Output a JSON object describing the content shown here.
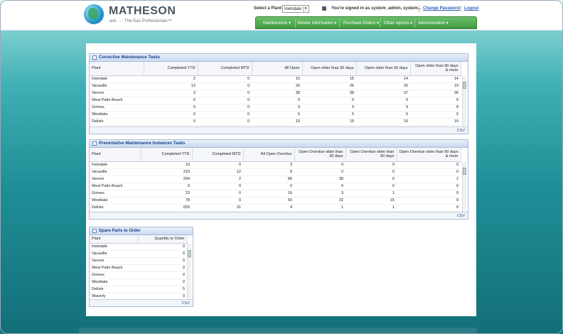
{
  "header": {
    "brand": "MATHESON",
    "tagline": "ask . . . The Gas Professionals™",
    "plant_label": "Select a Plant",
    "plant_value": "Irwindale",
    "signed_in": "You're signed in as system_admin, system...",
    "change_password": "Change Password",
    "logout": "Logout"
  },
  "nav": [
    "Maintenance ▾",
    "Vendor Information ▾",
    "Purchase Orders ▾",
    "Other reports ▾",
    "Administration ▾"
  ],
  "corrective": {
    "title": "Corrective Maintenance Tasks",
    "columns": [
      "Plant",
      "Completed YTD",
      "Completed MTD",
      "All Open",
      "Open older than 30 days",
      "Open older than 60 days",
      "Open older than 90 days & more"
    ],
    "rows": [
      [
        "Irwindale",
        "2",
        "0",
        "15",
        "15",
        "14",
        "14"
      ],
      [
        "Vacaville",
        "13",
        "0",
        "26",
        "26",
        "20",
        "19"
      ],
      [
        "Vernon",
        "3",
        "0",
        "38",
        "38",
        "37",
        "36"
      ],
      [
        "West Palm Beach",
        "0",
        "0",
        "0",
        "0",
        "0",
        "0"
      ],
      [
        "Grimes",
        "0",
        "0",
        "9",
        "9",
        "9",
        "8"
      ],
      [
        "Westlake",
        "0",
        "0",
        "5",
        "5",
        "5",
        "5"
      ],
      [
        "Delisle",
        "5",
        "0",
        "19",
        "19",
        "19",
        "19"
      ]
    ],
    "csv": "CSV"
  },
  "preventative": {
    "title": "Preventative Maintenance Instances Tasks",
    "columns": [
      "Plant",
      "Completed YTD",
      "Completed MTD",
      "All Open Overdue",
      "Open Overdue older than 30 days",
      "Open Overdue older than 60 days",
      "Open Overdue older than 90 days & more"
    ],
    "rows": [
      [
        "Irwindale",
        "19",
        "0",
        "3",
        "0",
        "0",
        "0"
      ],
      [
        "Vacaville",
        "219",
        "12",
        "8",
        "0",
        "0",
        "0"
      ],
      [
        "Vernon",
        "294",
        "2",
        "89",
        "38",
        "6",
        "2"
      ],
      [
        "West Palm Beach",
        "0",
        "0",
        "0",
        "0",
        "0",
        "0"
      ],
      [
        "Grimes",
        "23",
        "0",
        "10",
        "3",
        "1",
        "0"
      ],
      [
        "Westlake",
        "78",
        "0",
        "50",
        "32",
        "15",
        "9"
      ],
      [
        "Delisle",
        "659",
        "31",
        "4",
        "1",
        "1",
        "0"
      ]
    ],
    "csv": "CSV"
  },
  "spare": {
    "title": "Spare Parts to Order",
    "columns": [
      "Plant",
      "Quantity to Order"
    ],
    "rows": [
      [
        "Irwindale",
        "0"
      ],
      [
        "Vacaville",
        "0"
      ],
      [
        "Vernon",
        "0"
      ],
      [
        "West Palm Beach",
        "0"
      ],
      [
        "Grimes",
        "0"
      ],
      [
        "Westlake",
        "0"
      ],
      [
        "Delisle",
        "5"
      ],
      [
        "Waverly",
        "0"
      ]
    ],
    "csv": "CSV"
  }
}
